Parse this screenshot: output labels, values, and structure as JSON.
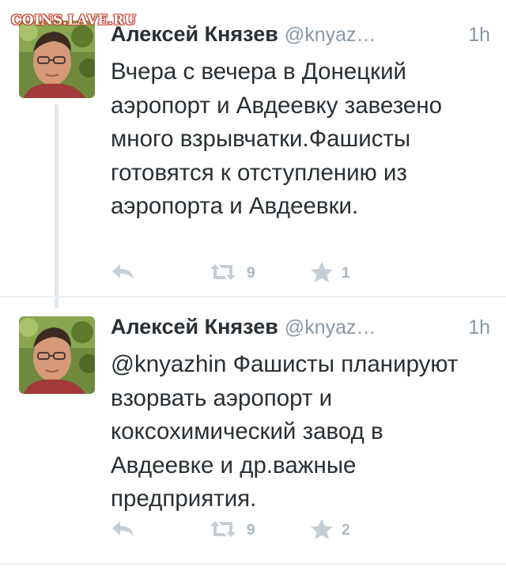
{
  "watermark": "COINS.LAVE.RU",
  "tweets": [
    {
      "author_name": "Алексей Князев",
      "author_handle": "@knyaz…",
      "time": "1h",
      "text": "Вчера с вечера в Донецкий аэропорт и Авдеевку завезено много взрывчатки.Фашисты готовятся к отступлению из аэропорта и Авдеевки.",
      "retweet_count": "9",
      "favorite_count": "1"
    },
    {
      "author_name": "Алексей Князев",
      "author_handle": "@knyaz…",
      "time": "1h",
      "text": "@knyazhin Фашисты планируют взорвать аэропорт и коксохимический завод в Авдеевке и др.важные предприятия.",
      "retweet_count": "9",
      "favorite_count": "2"
    }
  ],
  "icons": {
    "reply": "reply-icon",
    "retweet": "retweet-icon",
    "favorite": "star-icon"
  },
  "colors": {
    "text": "#292f33",
    "secondary": "#8899a6",
    "action_icon": "#c5ced6",
    "thread_line": "#e1e8ed"
  }
}
